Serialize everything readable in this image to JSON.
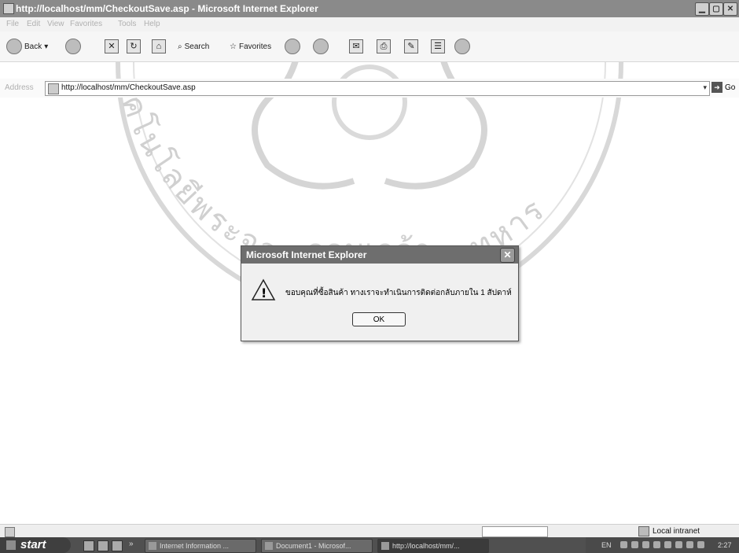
{
  "window": {
    "title": "http://localhost/mm/CheckoutSave.asp - Microsoft Internet Explorer",
    "minimize_icon": "minimize-icon",
    "maximize_icon": "maximize-icon",
    "close_icon": "close-icon"
  },
  "menu": [
    "File",
    "Edit",
    "View",
    "Favorites",
    "Tools",
    "Help"
  ],
  "toolbar": {
    "back_label": "Back",
    "search_label": "Search",
    "favorites_label": "Favorites"
  },
  "address": {
    "label": "Address",
    "url": "http://localhost/mm/CheckoutSave.asp",
    "go_label": "Go"
  },
  "watermark": {
    "text_upper": "คโนโลยีพระจอมเกล้าเจ้าคุณทหาร",
    "text_lower": "จอมเกล้า"
  },
  "dialog": {
    "title": "Microsoft Internet Explorer",
    "message": "ขอบคุณที่ซื้อสินค้า ทางเราจะทำเนินการติดต่อกลับภายใน 1 สัปดาห์",
    "ok_label": "OK",
    "icon": "warning-icon"
  },
  "status": {
    "zone": "Local intranet"
  },
  "taskbar": {
    "start_label": "start",
    "items": [
      {
        "label": "Internet Information ...",
        "active": false
      },
      {
        "label": "Document1 - Microsof...",
        "active": false
      },
      {
        "label": "http://localhost/mm/...",
        "active": true
      }
    ],
    "language": "EN",
    "clock": "2:27"
  }
}
